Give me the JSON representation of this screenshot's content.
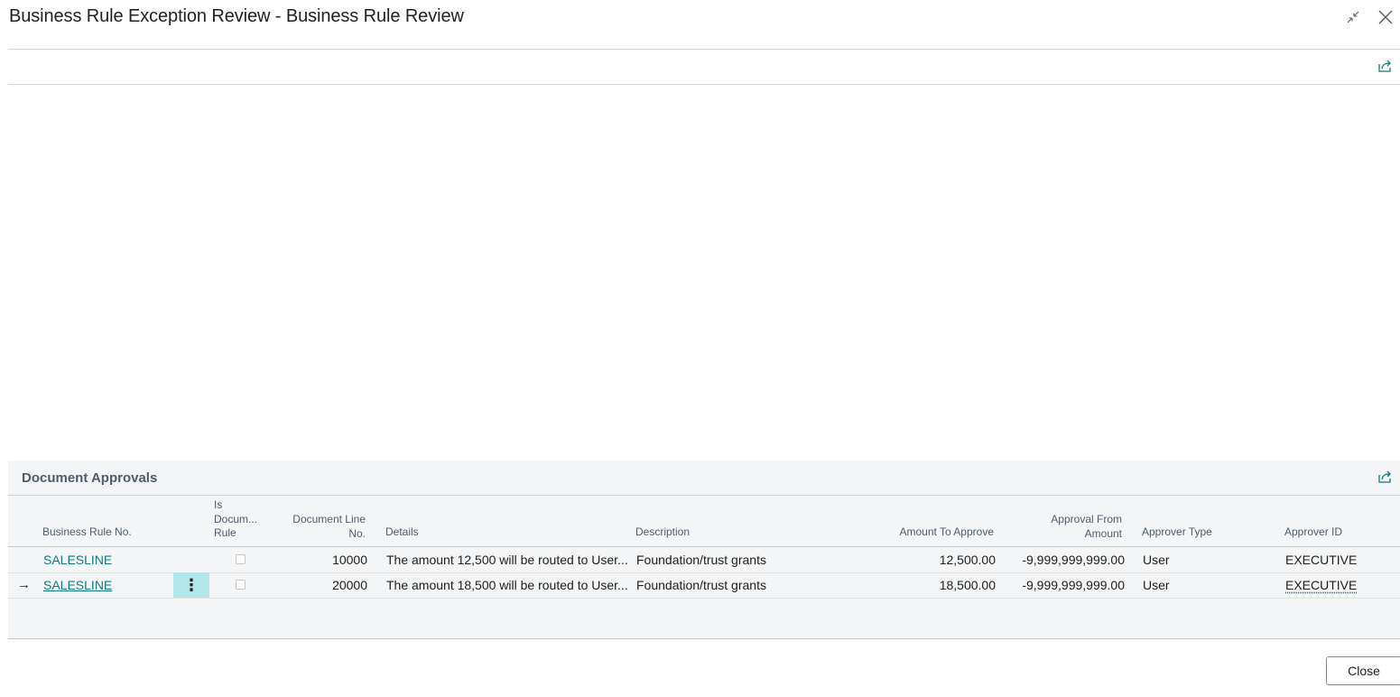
{
  "window": {
    "title": "Business Rule Exception Review - Business Rule Review",
    "icons": {
      "collapse": "collapse-arrows-icon",
      "close": "close-icon",
      "share": "share-icon"
    }
  },
  "part": {
    "title": "Document Approvals",
    "columns": {
      "business_rule_no": "Business Rule No.",
      "is_document_rule_1": "Is",
      "is_document_rule_2": "Docum...",
      "is_document_rule_3": "Rule",
      "document_line_no_1": "Document Line",
      "document_line_no_2": "No.",
      "details": "Details",
      "description": "Description",
      "amount_to_approve": "Amount To Approve",
      "approval_from_amount_1": "Approval From",
      "approval_from_amount_2": "Amount",
      "approver_type": "Approver Type",
      "approver_id": "Approver ID"
    },
    "rows": [
      {
        "business_rule_no": "SALESLINE",
        "is_document_rule": false,
        "document_line_no": "10000",
        "details": "The amount 12,500 will be routed to User...",
        "description": "Foundation/trust grants",
        "amount_to_approve": "12,500.00",
        "approval_from_amount": "-9,999,999,999.00",
        "approver_type": "User",
        "approver_id": "EXECUTIVE"
      },
      {
        "business_rule_no": "SALESLINE",
        "is_document_rule": false,
        "document_line_no": "20000",
        "details": "The amount 18,500 will be routed to User...",
        "description": "Foundation/trust grants",
        "amount_to_approve": "18,500.00",
        "approval_from_amount": "-9,999,999,999.00",
        "approver_type": "User",
        "approver_id": "EXECUTIVE",
        "selected": true,
        "row_marker": "→",
        "menu_glyph": "⋮"
      }
    ]
  },
  "footer": {
    "close_label": "Close"
  },
  "colors": {
    "accent": "#0f7a82",
    "selected_menu": "#b2e7ea",
    "part_bg": "#f4f5f6"
  }
}
